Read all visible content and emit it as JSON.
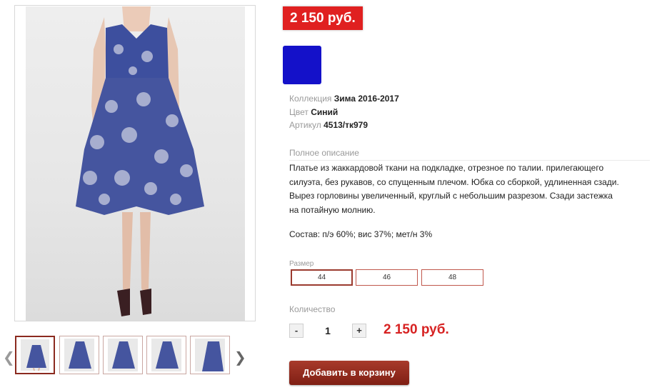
{
  "product": {
    "price_badge": "2 150 руб.",
    "color_swatch": "#1411c9",
    "collection_label": "Коллекция",
    "collection_value": "Зима 2016-2017",
    "color_label": "Цвет",
    "color_value": "Синий",
    "article_label": "Артикул",
    "article_value": "4513/тк979",
    "description_title": "Полное описание",
    "description_lines": [
      "Платье из жаккардовой ткани на подкладке, отрезное по талии. прилегающего",
      "силуэта, без рукавов, со спущенным плечом. Юбка со сборкой, удлиненная сзади.",
      "Вырез горловины увеличенный, круглый с небольшим разрезом. Сзади застежка",
      "на потайную молнию."
    ],
    "composition": "Состав: п/э 60%; вис 37%; мет/н 3%",
    "size_title": "Размер",
    "sizes": [
      "44",
      "46",
      "48"
    ],
    "selected_size": "44",
    "quantity_title": "Количество",
    "quantity_minus": "-",
    "quantity_value": "1",
    "quantity_plus": "+",
    "total_price": "2 150 руб.",
    "add_to_cart": "Добавить в корзину"
  },
  "gallery": {
    "prev_icon": "chevron-left-icon",
    "next_icon": "chevron-right-icon",
    "thumbnail_count": 5,
    "active_thumbnail": 1
  },
  "colors": {
    "accent_red": "#e02020",
    "cart_button": "#8b2a1f",
    "dress_blue": "#3d4f9e"
  }
}
